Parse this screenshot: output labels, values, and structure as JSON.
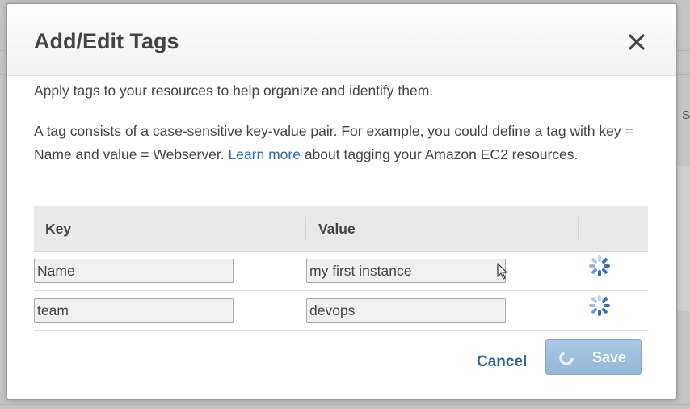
{
  "dialog": {
    "title": "Add/Edit Tags",
    "intro": "Apply tags to your resources to help organize and identify them.",
    "description_before_link": "A tag consists of a case-sensitive key-value pair. For example, you could define a tag with key = Name and value = Webserver.",
    "learn_more_link": "Learn more",
    "description_after_link": "about tagging your Amazon EC2 resources.",
    "close_icon": "close-icon"
  },
  "table": {
    "headers": {
      "key": "Key",
      "value": "Value"
    },
    "rows": [
      {
        "key": "Name",
        "value": "my first instance",
        "action_icon": "loading-spinner-icon"
      },
      {
        "key": "team",
        "value": "devops",
        "action_icon": "loading-spinner-icon"
      }
    ]
  },
  "footer": {
    "cancel_label": "Cancel",
    "save_label": "Save",
    "save_icon": "loading-spinner-icon"
  },
  "background": {
    "edge_text": "S"
  },
  "colors": {
    "link": "#2c6bb3",
    "save_button": "#a3c2e2",
    "spinner": "#3a6fb5"
  }
}
